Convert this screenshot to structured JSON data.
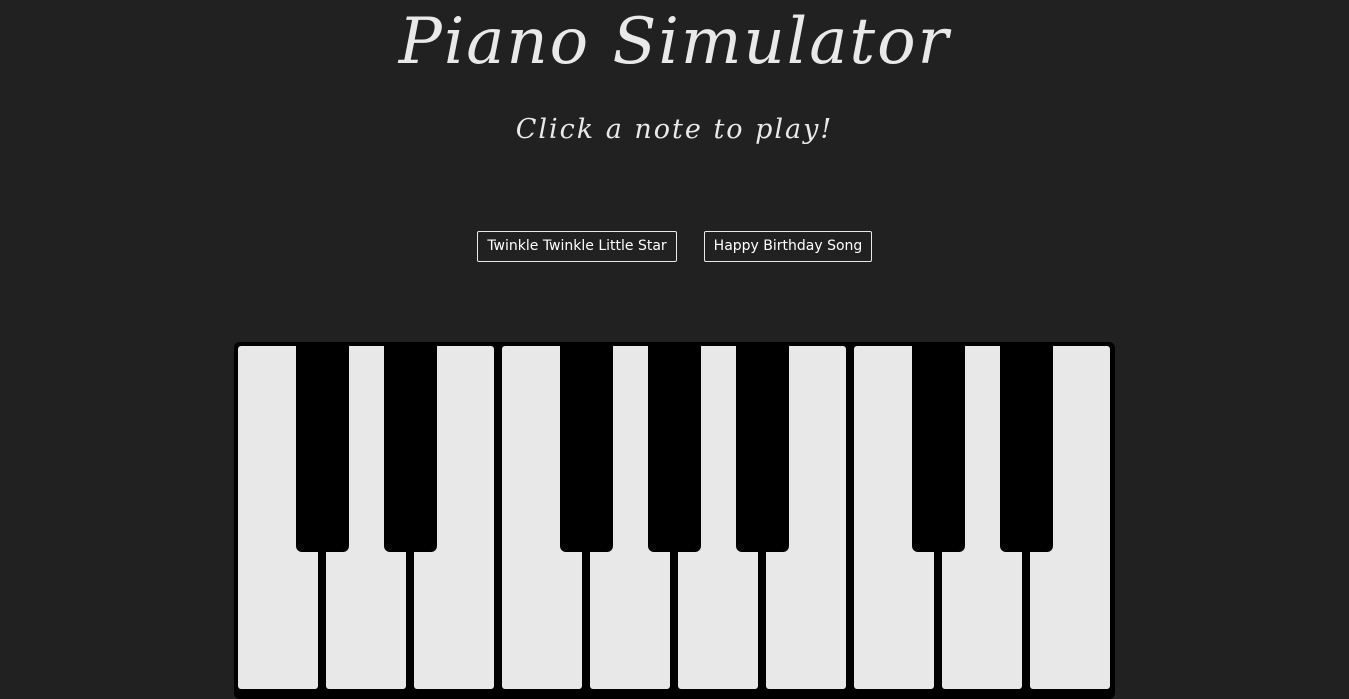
{
  "header": {
    "title": "Piano Simulator",
    "subtitle": "Click a note to play!"
  },
  "songs": {
    "twinkle_label": "Twinkle Twinkle Little Star",
    "birthday_label": "Happy Birthday Song"
  },
  "piano": {
    "white_keys": 10,
    "black_keys": 7,
    "colors": {
      "background": "#212121",
      "white_key": "#e8e8e8",
      "black_key": "#000000",
      "text": "#e9e9e9"
    }
  }
}
